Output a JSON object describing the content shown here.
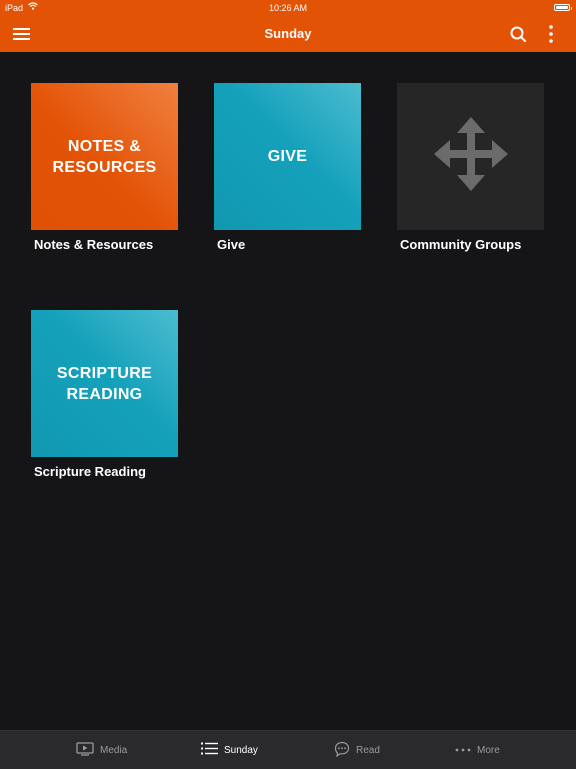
{
  "status_bar": {
    "device": "iPad",
    "time": "10:26 AM"
  },
  "nav": {
    "title": "Sunday"
  },
  "tiles": [
    {
      "tile_text": "NOTES &\nRESOURCES",
      "label": "Notes & Resources",
      "color": "#e35306"
    },
    {
      "tile_text": "GIVE",
      "label": "Give",
      "color": "#15a1bb"
    },
    {
      "icon": "move-arrows-icon",
      "label": "Community Groups",
      "color": "#262627"
    },
    {
      "tile_text": "SCRIPTURE\nREADING",
      "label": "Scripture Reading",
      "color": "#15a1bb"
    }
  ],
  "tabbar": {
    "tabs": [
      {
        "label": "Media",
        "icon": "tv-icon",
        "active": false
      },
      {
        "label": "Sunday",
        "icon": "list-icon",
        "active": true
      },
      {
        "label": "Read",
        "icon": "chat-bubble-icon",
        "active": false
      },
      {
        "label": "More",
        "icon": "more-dots-icon",
        "active": false
      }
    ]
  },
  "colors": {
    "accent": "#e35306",
    "background": "#151517",
    "tabbar": "#2a2a2c"
  }
}
